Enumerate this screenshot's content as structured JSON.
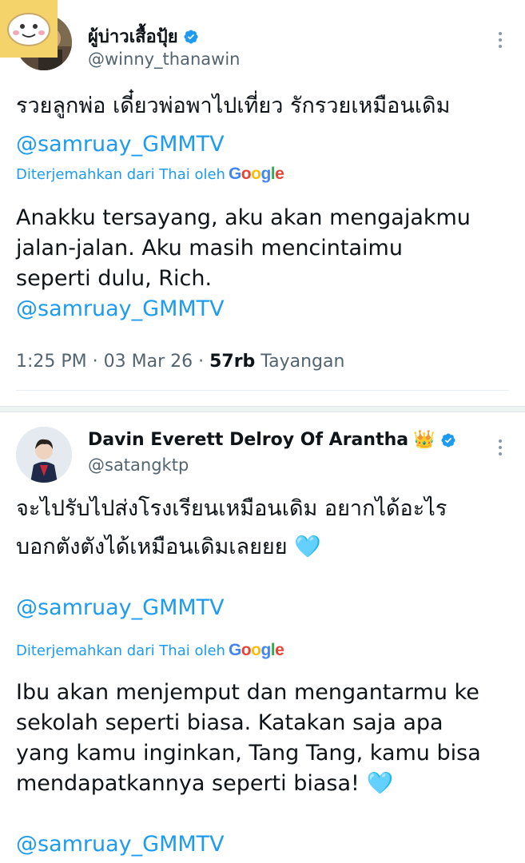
{
  "tweets": [
    {
      "display_name": "ผู้บ่าวเสื้อปุ้ย",
      "handle": "@winny_thanawin",
      "text_line1": "รวยลูกพ่อ เดี๋ยวพ่อพาไปเที่ยว รักรวยเหมือนเดิม",
      "mention": "@samruay_GMMTV",
      "translated_from": "Diterjemahkan dari Thai oleh",
      "google": "Google",
      "translation_line1": "Anakku tersayang, aku akan mengajakmu",
      "translation_line2": "jalan-jalan. Aku masih mencintaimu",
      "translation_line3": "seperti dulu, Rich.",
      "translation_mention": "@samruay_GMMTV",
      "time": "1:25 PM · 03 Mar 26 · ",
      "views_count": "57rb",
      "views_label": " Tayangan"
    },
    {
      "display_name": "Davin Everett Delroy Of Arantha",
      "crown": "👑",
      "handle": "@satangktp",
      "text_line1": "จะไปรับไปส่งโรงเรียนเหมือนเดิม อยากได้อะไร",
      "text_line2": "บอกตังตังได้เหมือนเดิมเลยยย",
      "heart": "🩵",
      "mention": "@samruay_GMMTV",
      "translated_from": "Diterjemahkan dari Thai oleh",
      "google": "Google",
      "translation_line1": "Ibu akan menjemput dan mengantarmu ke",
      "translation_line2": "sekolah seperti biasa. Katakan saja apa",
      "translation_line3": "yang kamu inginkan, Tang Tang, kamu bisa",
      "translation_line4": "mendapatkannya seperti biasa!",
      "translation_heart": "🩵",
      "translation_mention": "@samruay_GMMTV"
    }
  ],
  "colors": {
    "link": "#1d9bf0",
    "text": "#0f1419",
    "muted": "#536471",
    "verified": "#1d9bf0"
  }
}
